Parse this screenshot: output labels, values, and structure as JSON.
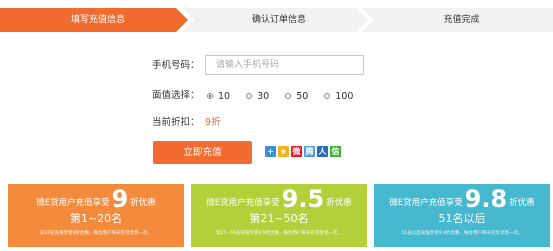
{
  "steps": [
    {
      "label": "填写充值信息",
      "active": true
    },
    {
      "label": "确认订单信息",
      "active": false
    },
    {
      "label": "充值完成",
      "active": false
    }
  ],
  "form": {
    "phone_label": "手机号码：",
    "phone_placeholder": "请输入手机号码",
    "phone_value": "",
    "amount_label": "面值选择：",
    "amount_options": [
      "10",
      "30",
      "50",
      "100"
    ],
    "amount_selected": "10",
    "discount_label": "当前折扣：",
    "discount_value": "9折",
    "submit_label": "立即充值"
  },
  "share_icons": [
    {
      "name": "plus-share-icon",
      "glyph": "+",
      "color": "#3a8fd8"
    },
    {
      "name": "qzone-icon",
      "glyph": "★",
      "color": "#f3b41b"
    },
    {
      "name": "weibo-icon",
      "glyph": "微",
      "color": "#e6162d"
    },
    {
      "name": "tencent-weibo-icon",
      "glyph": "腾",
      "color": "#4a9ed8"
    },
    {
      "name": "renren-icon",
      "glyph": "人",
      "color": "#2f6bb4"
    },
    {
      "name": "wechat-icon",
      "glyph": "信",
      "color": "#3cb034"
    }
  ],
  "promos": [
    {
      "prefix": "微E贷用户充值享受",
      "discount": "9",
      "suffix": "折优惠",
      "rank": "第1~20名",
      "note": "前20名充值享受9折优惠，每位用户每天仅可享受一次。",
      "color": "#f48b3c"
    },
    {
      "prefix": "微E贷用户充值享受",
      "discount": "9.5",
      "suffix": "折优惠",
      "rank": "第21~50名",
      "note": "第21~50名充值享受9.5折优惠，每位用户每天仅可享受一次。",
      "color": "#b3cf3a"
    },
    {
      "prefix": "微E贷用户充值享受",
      "discount": "9.8",
      "suffix": "折优惠",
      "rank": "51名以后",
      "note": "51名以后充值享受9.8折优惠，每位用户每天仅可享受一次。",
      "color": "#46b8cf"
    }
  ]
}
